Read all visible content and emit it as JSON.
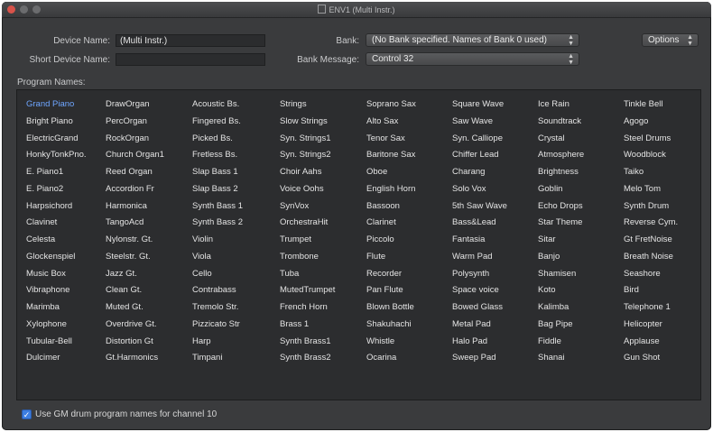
{
  "window": {
    "title": "ENV1 (Multi Instr.)"
  },
  "form": {
    "device_name_label": "Device Name:",
    "device_name_value": "(Multi Instr.)",
    "short_device_name_label": "Short Device Name:",
    "short_device_name_value": "",
    "bank_label": "Bank:",
    "bank_value": "(No Bank specified. Names of Bank 0 used)",
    "bank_message_label": "Bank Message:",
    "bank_message_value": "Control 32",
    "options_label": "Options",
    "program_names_label": "Program Names:"
  },
  "program_columns": [
    [
      "Grand Piano",
      "Bright Piano",
      "ElectricGrand",
      "HonkyTonkPno.",
      "E. Piano1",
      "E. Piano2",
      "Harpsichord",
      "Clavinet",
      "Celesta",
      "Glockenspiel",
      "Music Box",
      "Vibraphone",
      "Marimba",
      "Xylophone",
      "Tubular-Bell",
      "Dulcimer"
    ],
    [
      "DrawOrgan",
      "PercOrgan",
      "RockOrgan",
      "Church Organ1",
      "Reed Organ",
      "Accordion Fr",
      "Harmonica",
      "TangoAcd",
      "Nylonstr. Gt.",
      "Steelstr. Gt.",
      "Jazz Gt.",
      "Clean Gt.",
      "Muted Gt.",
      "Overdrive Gt.",
      "Distortion Gt",
      "Gt.Harmonics"
    ],
    [
      "Acoustic Bs.",
      "Fingered Bs.",
      "Picked Bs.",
      "Fretless Bs.",
      "Slap Bass 1",
      "Slap Bass 2",
      "Synth Bass 1",
      "Synth Bass 2",
      "Violin",
      "Viola",
      "Cello",
      "Contrabass",
      "Tremolo Str.",
      "Pizzicato Str",
      "Harp",
      "Timpani"
    ],
    [
      "Strings",
      "Slow Strings",
      "Syn. Strings1",
      "Syn. Strings2",
      "Choir Aahs",
      "Voice Oohs",
      "SynVox",
      "OrchestraHit",
      "Trumpet",
      "Trombone",
      "Tuba",
      "MutedTrumpet",
      "French Horn",
      "Brass 1",
      "Synth Brass1",
      "Synth Brass2"
    ],
    [
      "Soprano Sax",
      "Alto Sax",
      "Tenor Sax",
      "Baritone Sax",
      "Oboe",
      "English Horn",
      "Bassoon",
      "Clarinet",
      "Piccolo",
      "Flute",
      "Recorder",
      "Pan Flute",
      "Blown Bottle",
      "Shakuhachi",
      "Whistle",
      "Ocarina"
    ],
    [
      "Square Wave",
      "Saw Wave",
      "Syn. Calliope",
      "Chiffer Lead",
      "Charang",
      "Solo Vox",
      "5th Saw Wave",
      "Bass&Lead",
      "Fantasia",
      "Warm Pad",
      "Polysynth",
      "Space voice",
      "Bowed Glass",
      "Metal Pad",
      "Halo Pad",
      "Sweep Pad"
    ],
    [
      "Ice Rain",
      "Soundtrack",
      "Crystal",
      "Atmosphere",
      "Brightness",
      "Goblin",
      "Echo Drops",
      "Star Theme",
      "Sitar",
      "Banjo",
      "Shamisen",
      "Koto",
      "Kalimba",
      "Bag Pipe",
      "Fiddle",
      "Shanai"
    ],
    [
      "Tinkle Bell",
      "Agogo",
      "Steel Drums",
      "Woodblock",
      "Taiko",
      "Melo Tom",
      "Synth Drum",
      "Reverse Cym.",
      "Gt FretNoise",
      "Breath Noise",
      "Seashore",
      "Bird",
      "Telephone 1",
      "Helicopter",
      "Applause",
      "Gun Shot"
    ]
  ],
  "selected_program": "Grand Piano",
  "checkbox": {
    "label": "Use GM drum program names for channel 10",
    "checked": true
  },
  "colors": {
    "window_bg": "#3a3b3d",
    "list_bg": "#2c2d2f",
    "selected_text": "#6fa6ff",
    "checkbox_blue": "#3d7ee0"
  }
}
